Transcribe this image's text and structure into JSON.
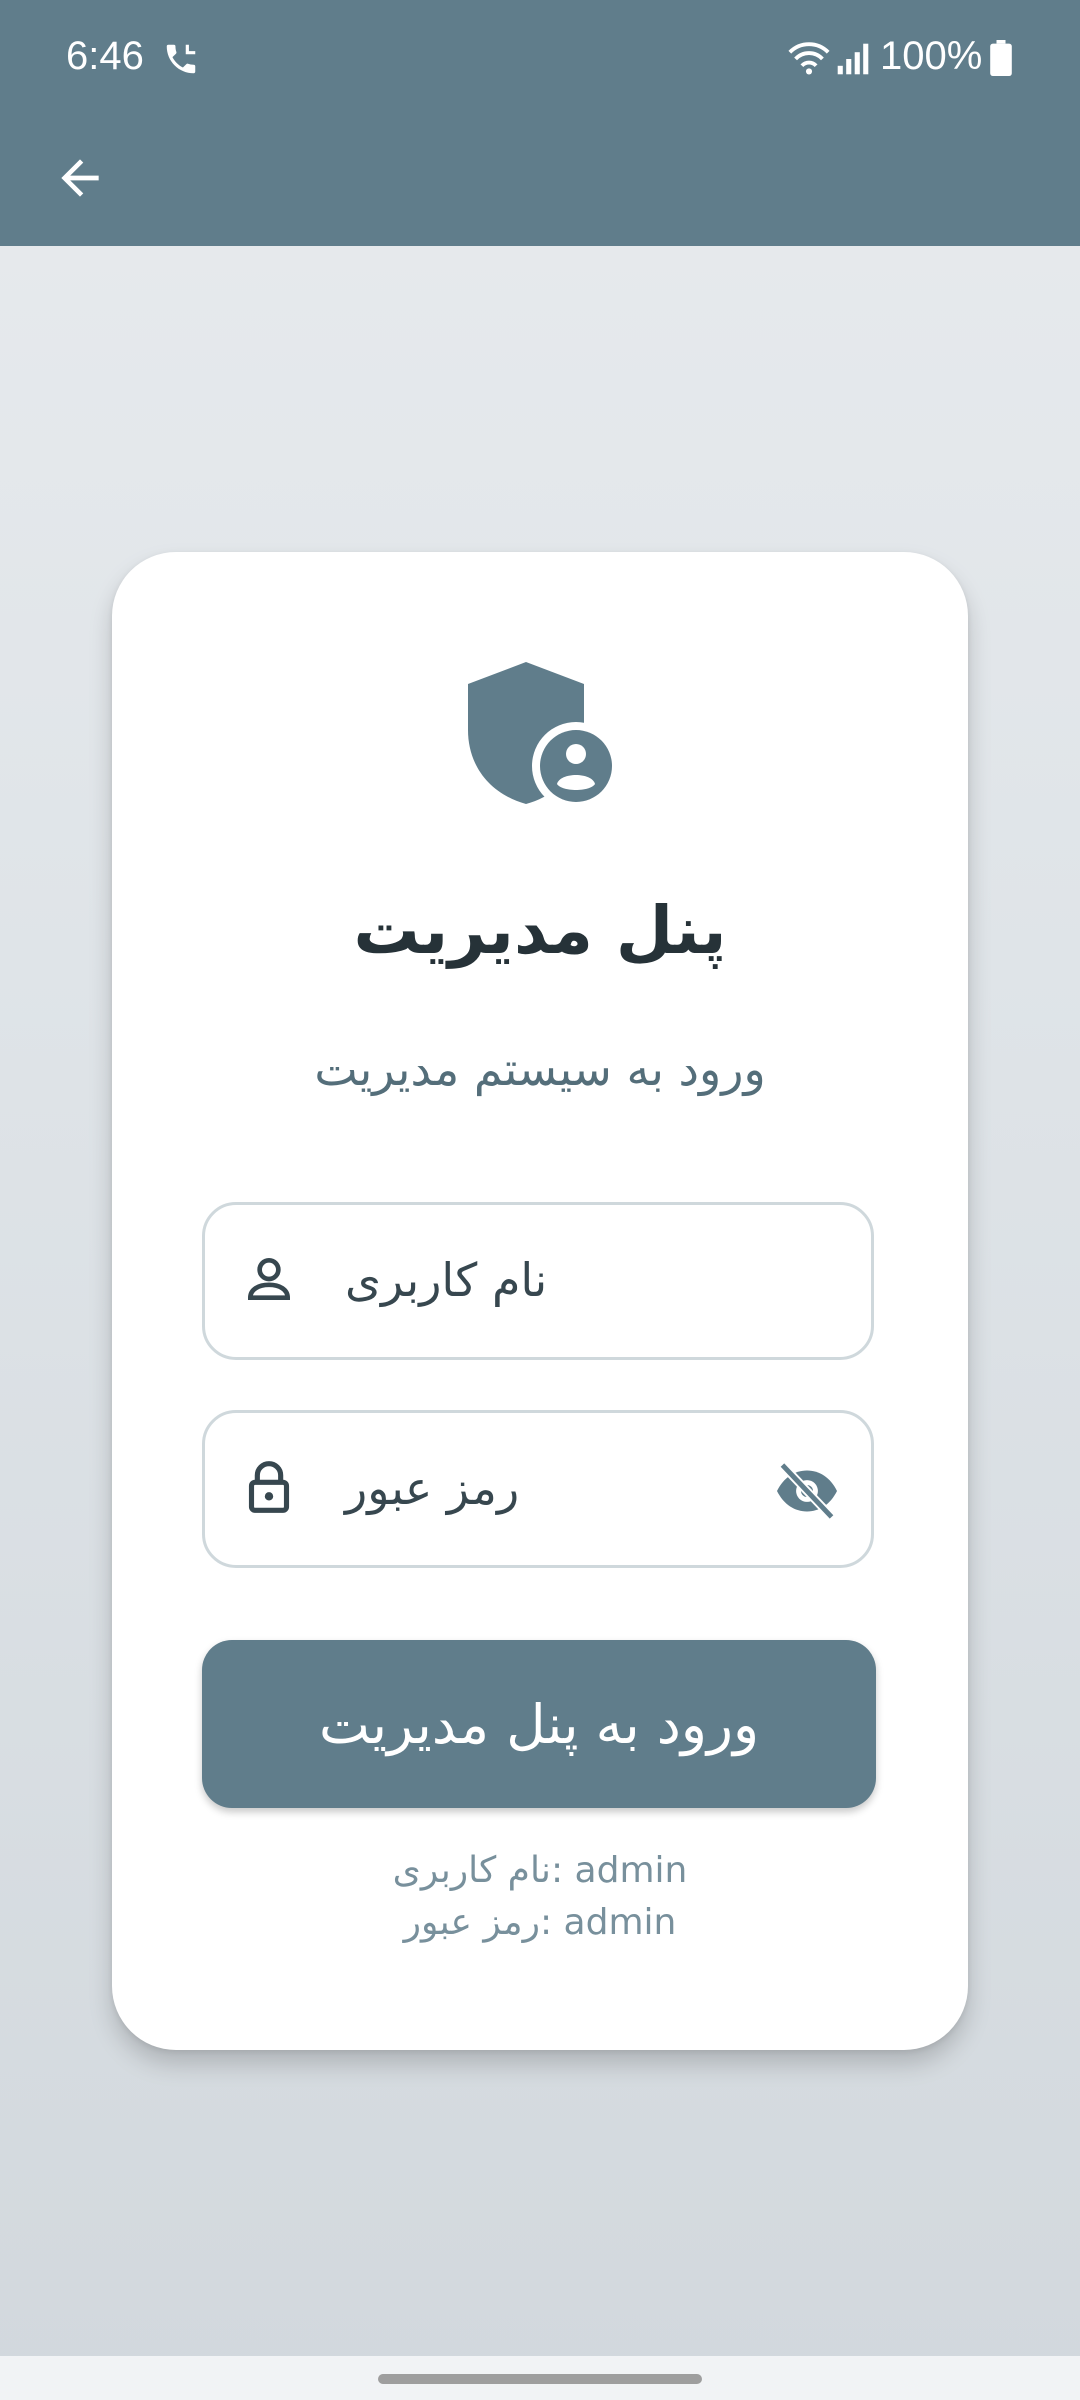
{
  "status_bar": {
    "time": "6:46",
    "battery_text": "100%",
    "icons": [
      "call-icon",
      "wifi-icon",
      "signal-icon",
      "battery-icon"
    ]
  },
  "app_bar": {
    "back_icon": "arrow-back-icon"
  },
  "login_card": {
    "icon": "admin-shield-icon",
    "title": "پنل مدیریت",
    "subtitle": "ورود به سیستم مدیریت",
    "username_field": {
      "placeholder": "نام کاربری",
      "value": "",
      "icon": "person-icon"
    },
    "password_field": {
      "placeholder": "رمز عبور",
      "value": "",
      "icon": "lock-icon",
      "toggle_icon": "eye-off-icon"
    },
    "submit_label": "ورود به پنل مدیریت",
    "hint_username": "نام کاربری: admin",
    "hint_password": "رمز عبور: admin"
  },
  "colors": {
    "primary": "#607d8b",
    "title_text": "#263238",
    "subtitle_text": "#546e7a",
    "hint_text": "#78909c",
    "field_border": "#cfd8dc"
  }
}
